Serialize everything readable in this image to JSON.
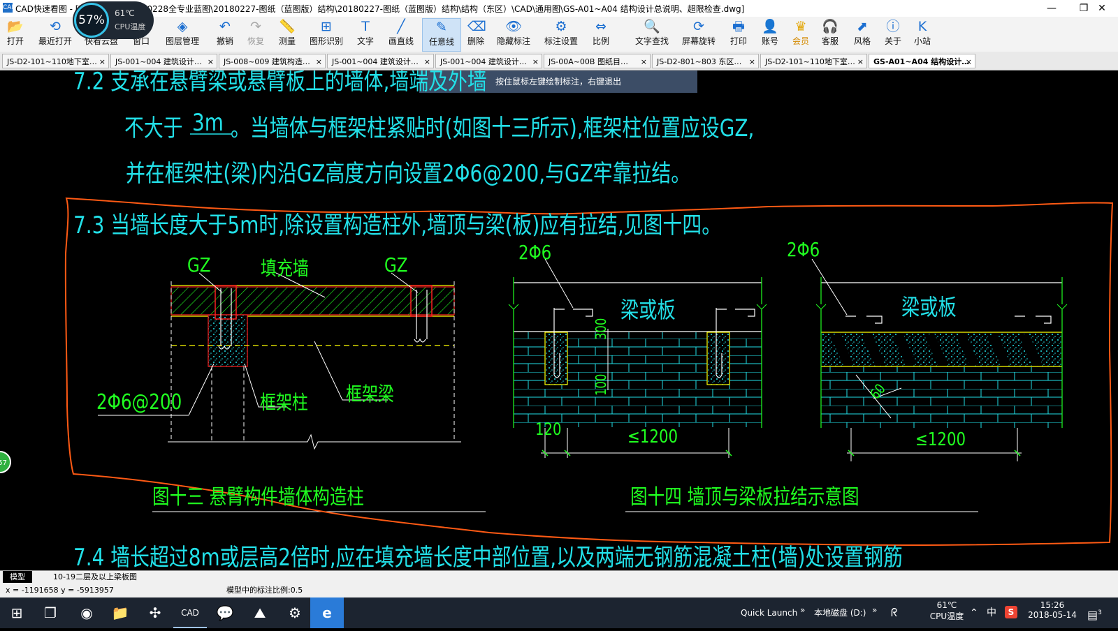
{
  "window": {
    "title": "CAD快速看图 - [\\\\...1楼二期-20180228全专业蓝图\\20180227-图纸（蓝图版）结构\\20180227-图纸（蓝图版）结构\\结构（东区）\\CAD\\通用图\\GS-A01~A04 结构设计总说明、超限检查.dwg]",
    "app_icon": "CAD",
    "minimize": "—",
    "maximize": "❐",
    "close": "✕"
  },
  "cpu_widget": {
    "percent": "57%",
    "temp": "61℃",
    "label": "CPU温度"
  },
  "toolbar": [
    {
      "id": "open",
      "label": "打开",
      "icon": "folder-icon",
      "glyph": "📂"
    },
    {
      "id": "recent",
      "label": "最近打开",
      "icon": "history-icon",
      "glyph": "⟲"
    },
    {
      "id": "cloud",
      "label": "快看云盘",
      "icon": "cloud-icon",
      "glyph": "☁"
    },
    {
      "id": "window",
      "label": "窗口",
      "icon": "window-icon",
      "glyph": "▣"
    },
    {
      "id": "layers",
      "label": "图层管理",
      "icon": "layers-icon",
      "glyph": "◈"
    },
    {
      "id": "undo",
      "label": "撤销",
      "icon": "undo-icon",
      "glyph": "↶"
    },
    {
      "id": "redo",
      "label": "恢复",
      "icon": "redo-icon",
      "glyph": "↷",
      "disabled": true
    },
    {
      "id": "measure",
      "label": "测量",
      "icon": "ruler-icon",
      "glyph": "📏"
    },
    {
      "id": "recognize",
      "label": "图形识别",
      "icon": "recognize-icon",
      "glyph": "⊞"
    },
    {
      "id": "text",
      "label": "文字",
      "icon": "text-icon",
      "glyph": "T"
    },
    {
      "id": "line",
      "label": "画直线",
      "icon": "line-icon",
      "glyph": "╱"
    },
    {
      "id": "freeline",
      "label": "任意线",
      "icon": "pencil-icon",
      "glyph": "✎",
      "active": true
    },
    {
      "id": "delete",
      "label": "删除",
      "icon": "eraser-icon",
      "glyph": "⌫"
    },
    {
      "id": "hide",
      "label": "隐藏标注",
      "icon": "eye-icon",
      "glyph": "👁"
    },
    {
      "id": "annoset",
      "label": "标注设置",
      "icon": "settings-icon",
      "glyph": "⚙"
    },
    {
      "id": "scale",
      "label": "比例",
      "icon": "scale-icon",
      "glyph": "⇔"
    },
    {
      "id": "findtext",
      "label": "文字查找",
      "icon": "find-icon",
      "glyph": "🔍"
    },
    {
      "id": "rotate",
      "label": "屏幕旋转",
      "icon": "rotate-icon",
      "glyph": "⟳"
    },
    {
      "id": "print",
      "label": "打印",
      "icon": "printer-icon",
      "glyph": "🖶"
    },
    {
      "id": "account",
      "label": "账号",
      "icon": "user-icon",
      "glyph": "👤"
    },
    {
      "id": "vip",
      "label": "会员",
      "icon": "vip-icon",
      "glyph": "♛",
      "vip": true
    },
    {
      "id": "service",
      "label": "客服",
      "icon": "headset-icon",
      "glyph": "🎧"
    },
    {
      "id": "style",
      "label": "风格",
      "icon": "style-icon",
      "glyph": "⬈"
    },
    {
      "id": "about",
      "label": "关于",
      "icon": "info-icon",
      "glyph": "ⓘ"
    },
    {
      "id": "site",
      "label": "小站",
      "icon": "k-icon",
      "glyph": "K"
    }
  ],
  "tabs": [
    {
      "label": "JS-D2-101~110地下室…",
      "close": "×"
    },
    {
      "label": "JS-001~004 建筑设计…",
      "close": "×"
    },
    {
      "label": "JS-008~009 建筑构造…",
      "close": "×"
    },
    {
      "label": "JS-001~004 建筑设计…",
      "close": "×"
    },
    {
      "label": "JS-001~004 建筑设计…",
      "close": "×"
    },
    {
      "label": "JS-00A~00B 图纸目…",
      "close": "×"
    },
    {
      "label": "JS-D2-801~803 东区…",
      "close": "×"
    },
    {
      "label": "JS-D2-101~110地下室…",
      "close": "×"
    },
    {
      "label": "GS-A01~A04 结构设计…",
      "close": "×",
      "active": true
    }
  ],
  "hint": "按住鼠标左键绘制标注，右键退出",
  "drawing": {
    "line_72": "7.2  支承在悬臂梁或悬臂板上的墙体,墙端及外墙",
    "line_72b_pre": "不大于",
    "line_72b_val": "3m",
    "line_72b_post": "。当墙体与框架柱紧贴时(如图十三所示),框架柱位置应设GZ,",
    "line_72c": "并在框架柱(梁)内沿GZ高度方向设置2Φ6@200,与GZ牢靠拉结。",
    "line_73": "7.3  当墙长度大于5m时,除设置构造柱外,墙顶与梁(板)应有拉结,见图十四。",
    "line_74": "7.4  墙长超过8m或层高2倍时,应在填充墙长度中部位置,以及两端无钢筋混凝土柱(墙)处设置钢筋",
    "fig13": {
      "gz_left": "GZ",
      "fill_wall": "填充墙",
      "gz_right": "GZ",
      "rebar": "2Φ6@200",
      "frame_col": "框架柱",
      "frame_beam": "框架梁",
      "caption": "图十三  悬臂构件墙体构造柱"
    },
    "fig14": {
      "rebar_a": "2Φ6",
      "beam_a": "梁或板",
      "dim_300": "300",
      "dim_100": "100",
      "dim_120": "120",
      "dim_1200a": "≤1200",
      "rebar_b": "2Φ6",
      "beam_b": "梁或板",
      "dim_60": "60",
      "dim_1200b": "≤1200",
      "caption": "图十四  墙顶与梁板拉结示意图"
    }
  },
  "side_badge": "57",
  "sheets": {
    "model": "模型",
    "layout": "10-19二层及以上梁板图"
  },
  "status": {
    "coords": "x = -1191658  y = -5913957",
    "scale": "模型中的标注比例:0.5"
  },
  "taskbar": {
    "apps": [
      {
        "name": "start-icon",
        "glyph": "⊞"
      },
      {
        "name": "task-view-icon",
        "glyph": "❐"
      },
      {
        "name": "browser-360-icon",
        "glyph": "◉"
      },
      {
        "name": "file-explorer-icon",
        "glyph": "📁"
      },
      {
        "name": "network-app-icon",
        "glyph": "✣"
      },
      {
        "name": "cad-app-icon",
        "glyph": "CAD"
      },
      {
        "name": "wechat-icon",
        "glyph": "💬"
      },
      {
        "name": "photo-app-icon",
        "glyph": "⛰"
      },
      {
        "name": "game-app-icon",
        "glyph": "⚙"
      },
      {
        "name": "ie-icon",
        "glyph": "e"
      }
    ],
    "quick_launch": "Quick Launch",
    "chevron": "»",
    "disk": "本地磁盘 (D:)",
    "temp": "61℃",
    "temp_label": "CPU温度",
    "ime": "中",
    "time": "15:26",
    "date": "2018-05-14",
    "notifications": "3"
  },
  "colors": {
    "cad_cyan": "#22e0e8",
    "cad_green": "#20ff20",
    "cad_yellow": "#ffff00",
    "cad_red": "#ff2020",
    "annotation_orange": "#ff5a14"
  }
}
